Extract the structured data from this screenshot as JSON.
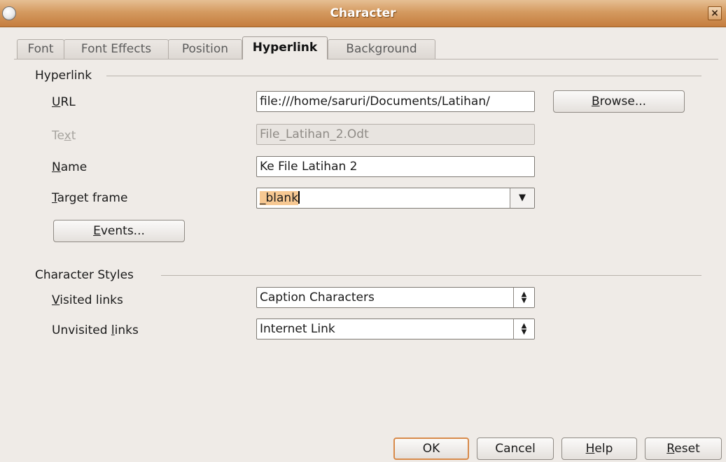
{
  "window": {
    "title": "Character",
    "close_label": "×"
  },
  "tabs": [
    {
      "label": "Font"
    },
    {
      "label": "Font Effects"
    },
    {
      "label": "Position"
    },
    {
      "label": "Hyperlink"
    },
    {
      "label": "Background"
    }
  ],
  "hyperlink": {
    "section_title": "Hyperlink",
    "url": {
      "label": "URL",
      "value": "file:///home/saruri/Documents/Latihan/"
    },
    "text": {
      "label": "Text",
      "value": "File_Latihan_2.Odt"
    },
    "name": {
      "label": "Name",
      "value": "Ke File Latihan 2"
    },
    "target_frame": {
      "label": "Target frame",
      "value": "_blank"
    },
    "browse_label": "Browse...",
    "events_label": "Events..."
  },
  "character_styles": {
    "section_title": "Character Styles",
    "visited": {
      "label": "Visited links",
      "value": "Caption Characters"
    },
    "unvisited": {
      "label": "Unvisited links",
      "value": "Internet Link"
    }
  },
  "buttons": {
    "ok": "OK",
    "cancel": "Cancel",
    "help": "Help",
    "reset": "Reset"
  },
  "icons": {
    "window": "app-icon",
    "close": "close-icon",
    "dropdown": "chevron-down-icon",
    "spin": "spin-updown-icon"
  },
  "colors": {
    "titlebar": "#d49a60",
    "dialog_bg": "#efebe7",
    "default_button_border": "#d88a4a",
    "selection": "#f7c892"
  }
}
